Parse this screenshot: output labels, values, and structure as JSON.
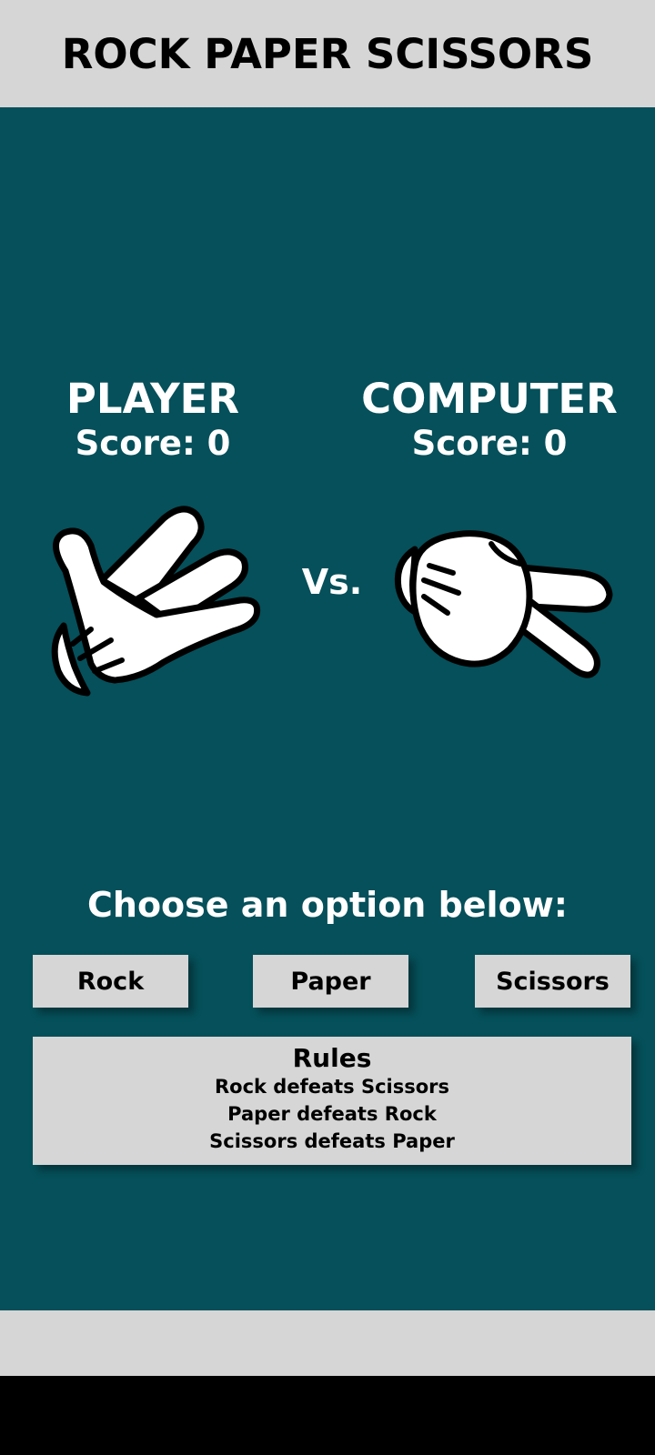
{
  "header": {
    "title": "ROCK PAPER SCISSORS"
  },
  "player": {
    "name": "PLAYER",
    "score_label": "Score: 0",
    "hand_icon": "scissors-hand-icon"
  },
  "computer": {
    "name": "COMPUTER",
    "score_label": "Score: 0",
    "hand_icon": "scissors-hand-icon"
  },
  "vs_label": "Vs.",
  "prompt": "Choose an option below:",
  "options": {
    "rock": "Rock",
    "paper": "Paper",
    "scissors": "Scissors"
  },
  "rules": {
    "title": "Rules",
    "items": [
      "Rock defeats Scissors",
      "Paper defeats Rock",
      "Scissors defeats Paper"
    ]
  },
  "colors": {
    "background": "#05505a",
    "header": "#d6d6d6",
    "button": "#d6d6d6",
    "text_light": "#ffffff",
    "text_dark": "#000000"
  }
}
